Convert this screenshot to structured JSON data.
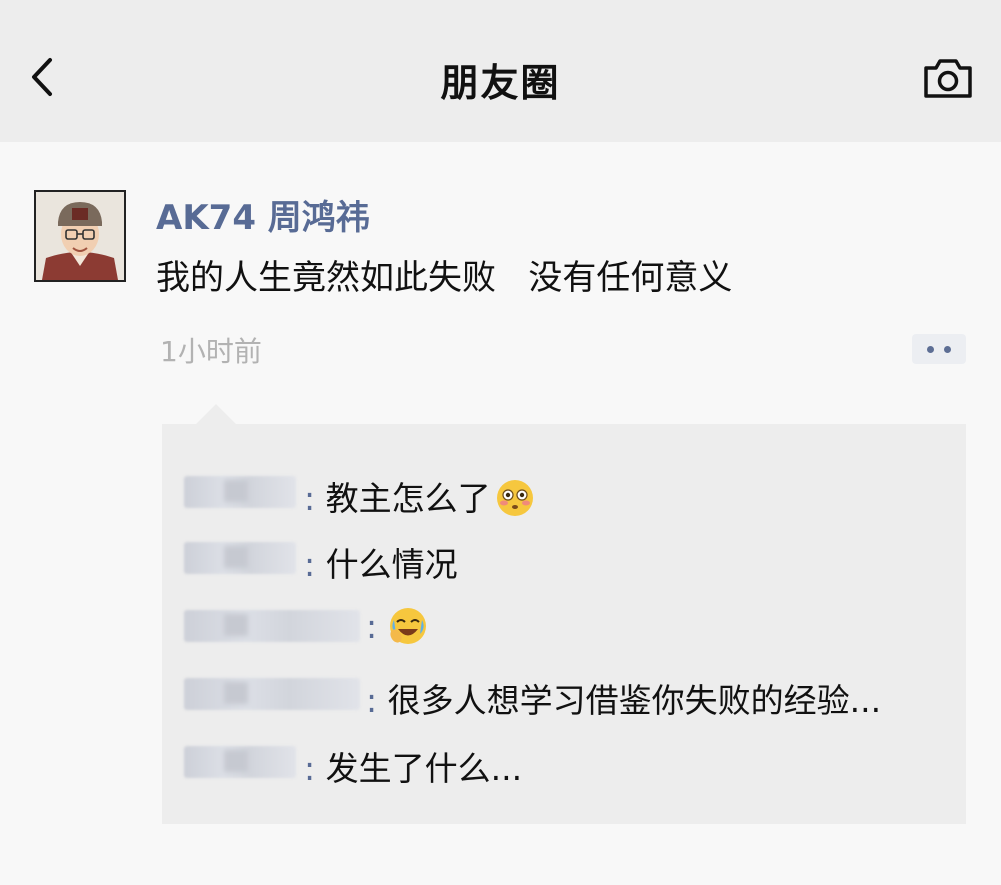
{
  "header": {
    "title": "朋友圈",
    "back_icon": "chevron-left-icon",
    "camera_icon": "camera-icon"
  },
  "post": {
    "author": "AK74 周鸿祎",
    "text": "我的人生竟然如此失败   没有任何意义",
    "time": "1小时前",
    "more_icon": "ellipsis-icon"
  },
  "comments": [
    {
      "author": "",
      "text": "教主怎么了",
      "emoji": "flushed-face-icon"
    },
    {
      "author": "",
      "text": "什么情况",
      "emoji": ""
    },
    {
      "author": "",
      "text": "",
      "emoji": "rolling-laughing-icon"
    },
    {
      "author": "",
      "text": "很多人想学习借鉴你失败的经验...",
      "emoji": ""
    },
    {
      "author": "",
      "text": "发生了什么...",
      "emoji": ""
    }
  ],
  "colors": {
    "link_blue": "#586b95",
    "header_bg": "#ededed",
    "comment_bg": "#ededed",
    "meta_gray": "#b2b2b2"
  }
}
